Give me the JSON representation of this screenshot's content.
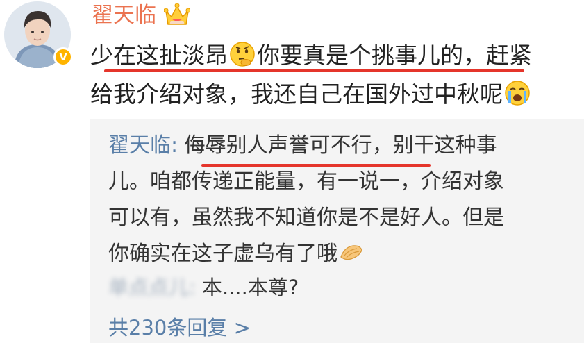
{
  "post": {
    "author_name": "翟天临",
    "lines": [
      {
        "part1": "少在这扯淡昂",
        "part2": "你要真是个挑事儿的，赶紧"
      },
      {
        "part1": "给我介绍对象，我还自己在国外过中秋呢"
      }
    ],
    "emoji_1": "thinking-face-icon",
    "emoji_2": "crying-face-icon"
  },
  "reply": {
    "author_name": "翟天临",
    "separator": ": ",
    "lines": [
      "侮辱别人声誉可不行，别干这种事",
      "儿。咱都传递正能量，有一说一，介绍对象",
      "可以有，虽然我不知道你是不是好人。但是",
      "你确实在这子虚乌有了哦"
    ],
    "emoji": "clapping-hands-icon",
    "sub_reply": {
      "author_name": "单点点儿:",
      "text": " 本....本尊?"
    },
    "more_label": "共230条回复 >"
  },
  "colors": {
    "username": "#eb7350",
    "link_blue": "#5a7fa8",
    "highlight_red": "#e5352b",
    "verified_gold": "#ffb400",
    "reply_bg": "#f4f4f4"
  }
}
